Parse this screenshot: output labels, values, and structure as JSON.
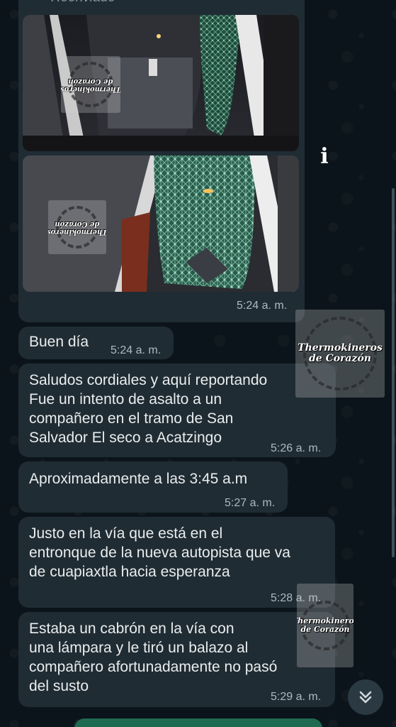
{
  "forward_label": "Reenviado",
  "colors": {
    "background": "#0b141a",
    "bubble": "#202c33",
    "text": "#e9edef",
    "meta": "#aebac1",
    "accent_green": "#1f6b52"
  },
  "watermark": {
    "line1": "Thermokineros",
    "line2": "de Corazón"
  },
  "messages": [
    {
      "text": "",
      "time": "5:24 a. m."
    },
    {
      "text": "Buen día",
      "time": "5:24 a. m."
    },
    {
      "text": "Saludos cordiales y aquí reportando\nFue un intento de asalto a un\ncompañero en el tramo de San\nSalvador El seco a Acatzingo",
      "time": "5:26 a. m."
    },
    {
      "text": "Aproximadamente a las 3:45 a.m",
      "time": "5:27 a. m."
    },
    {
      "text": "Justo en la vía que está en el\nentronque de la nueva autopista que va\nde cuapiaxtla hacia esperanza",
      "time": "5:28 a. m."
    },
    {
      "text": "Estaba un cabrón en la vía con\nuna lámpara y le tiró un balazo al\ncompañero afortunadamente no pasó\ndel susto",
      "time": "5:29 a. m."
    }
  ],
  "icons": {
    "info": "info-icon",
    "scroll_down": "double-chevron-down-icon"
  }
}
